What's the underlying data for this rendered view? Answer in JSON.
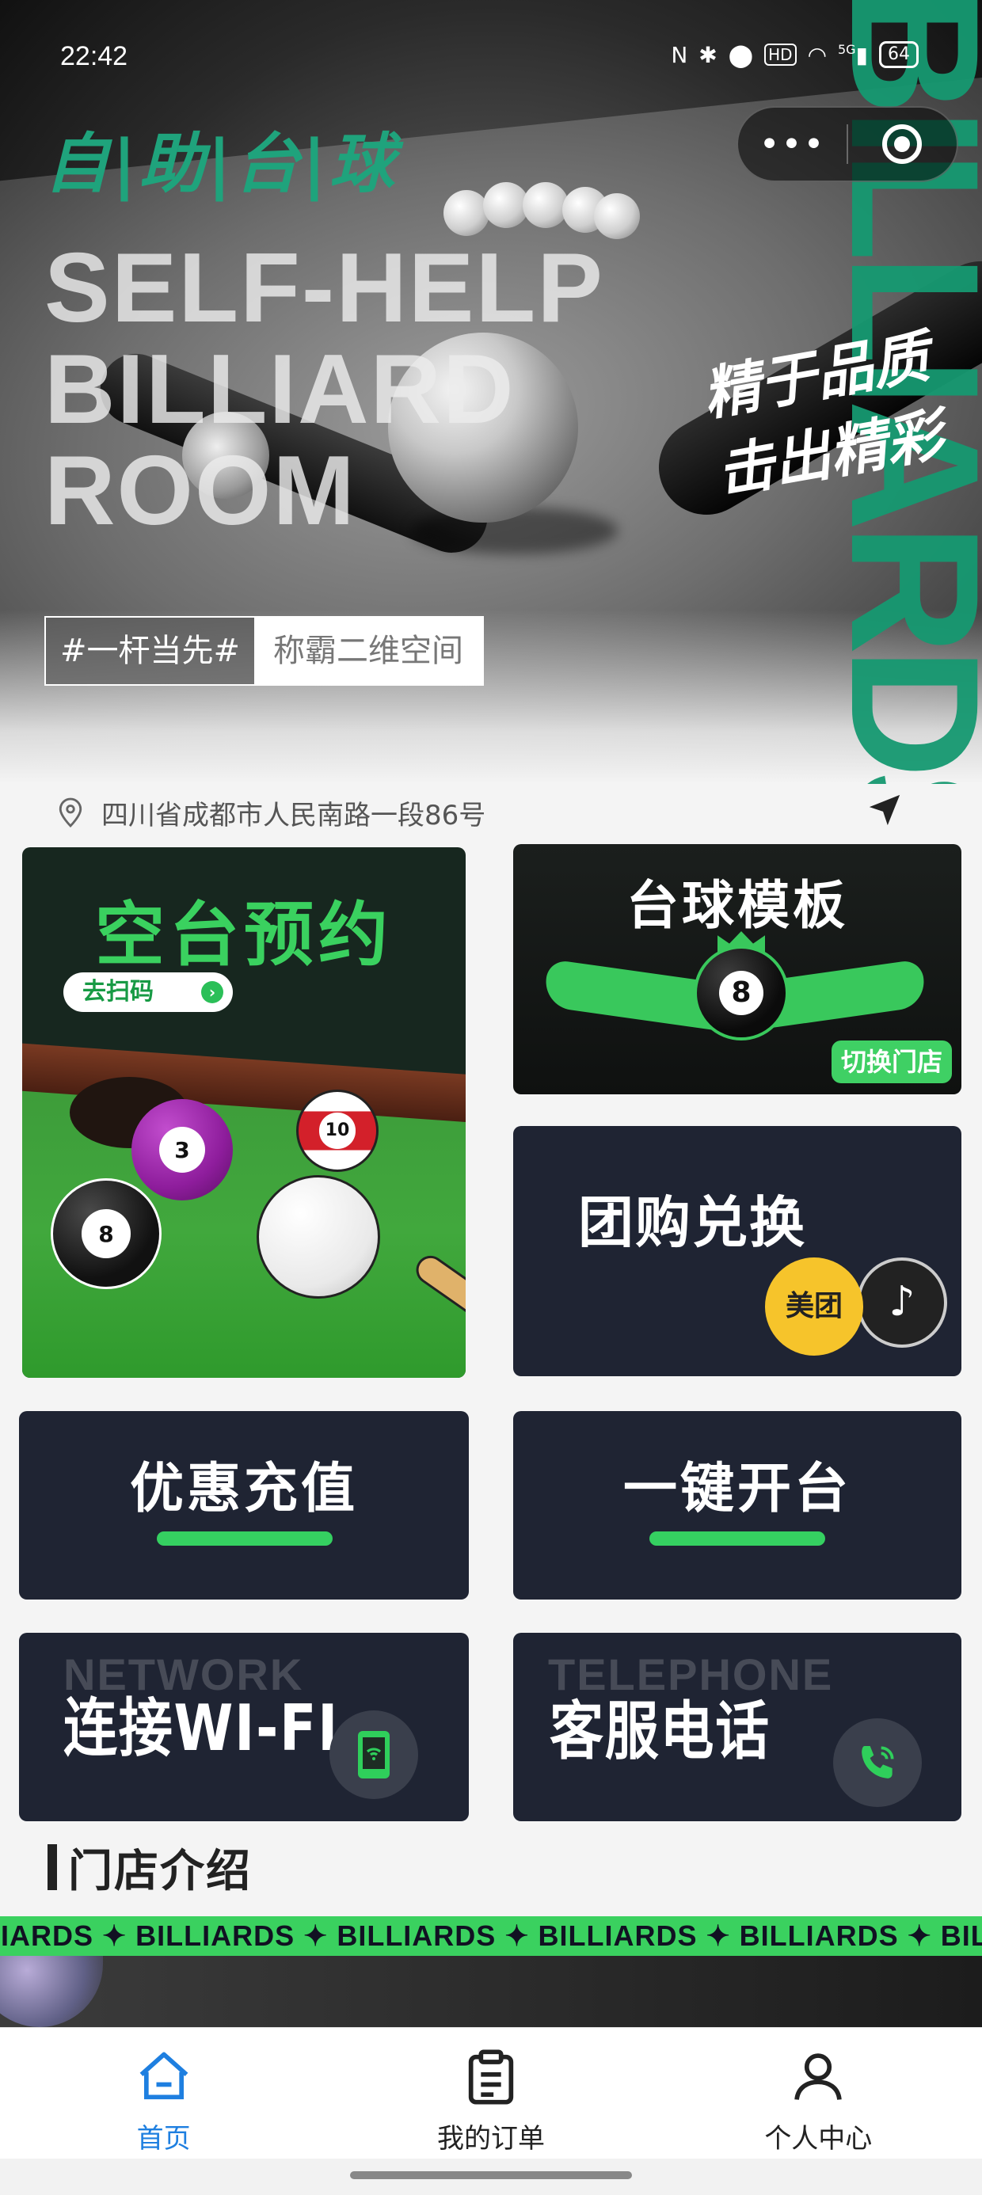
{
  "status_bar": {
    "time": "22:42",
    "network": "5G",
    "battery": "64",
    "hd": "HD"
  },
  "header": {
    "brand": "自|助|台|球"
  },
  "hero": {
    "eng_line1": "SELF-HELP",
    "eng_line2": "BILLIARD",
    "eng_line3": "ROOM",
    "slogan1": "精于品质",
    "slogan2": "击出精彩",
    "vertical_text": "BILLIARDS",
    "hashtag": "#一杆当先#",
    "hashtag_sub": "称霸二维空间"
  },
  "location": {
    "address": "四川省成都市人民南路一段86号"
  },
  "cards": {
    "reserve": {
      "title": "空台预约",
      "scan_label": "去扫码",
      "balls": [
        "3",
        "10",
        "8"
      ]
    },
    "template": {
      "title": "台球模板",
      "switch_label": "切换门店",
      "ball": "8"
    },
    "group": {
      "title": "团购兑换",
      "meituan": "美团",
      "tiktok_glyph": "♪"
    },
    "recharge": {
      "title": "优惠充值"
    },
    "open": {
      "title": "一键开台"
    },
    "wifi": {
      "ghost": "NETWORK",
      "title": "连接WI-FI"
    },
    "phone": {
      "ghost": "TELEPHONE",
      "title": "客服电话"
    }
  },
  "section": {
    "title": "门店介绍"
  },
  "marquee": {
    "text": "LIARDS ✦ BILLIARDS ✦ BILLIARDS ✦ BILLIARDS ✦ BILLIARDS ✦ BILLIARDS"
  },
  "tabbar": {
    "items": [
      {
        "label": "首页",
        "icon": "home-icon",
        "active": true
      },
      {
        "label": "我的订单",
        "icon": "orders-icon",
        "active": false
      },
      {
        "label": "个人中心",
        "icon": "profile-icon",
        "active": false
      }
    ]
  },
  "colors": {
    "accent_green": "#3ad15f",
    "brand_green": "#1fa37c",
    "card_bg": "#1f2433",
    "tab_active": "#1e7fe0"
  }
}
